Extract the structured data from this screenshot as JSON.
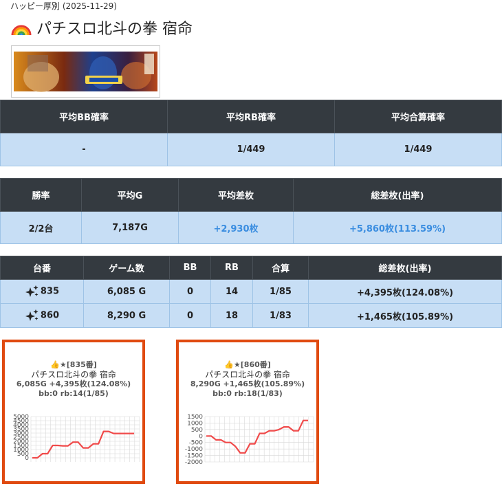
{
  "header": {
    "subtitle": "ハッピー厚別 (2025-11-29)",
    "title": "パチスロ北斗の拳 宿命",
    "icon": "rainbow-icon"
  },
  "summary1": {
    "headers": [
      "平均BB確率",
      "平均RB確率",
      "平均合算確率"
    ],
    "values": [
      "-",
      "1/449",
      "1/449"
    ]
  },
  "summary2": {
    "headers": [
      "勝率",
      "平均G",
      "平均差枚",
      "総差枚(出率)"
    ],
    "values": [
      "2/2台",
      "7,187G",
      "+2,930枚",
      "+5,860枚(113.59%)"
    ]
  },
  "machines": {
    "headers": [
      "台番",
      "ゲーム数",
      "BB",
      "RB",
      "合算",
      "総差枚(出率)"
    ],
    "rows": [
      {
        "no": "835",
        "games": "6,085 G",
        "bb": "0",
        "rb": "14",
        "total": "1/85",
        "diff": "+4,395枚(124.08%)"
      },
      {
        "no": "860",
        "games": "8,290 G",
        "bb": "0",
        "rb": "18",
        "total": "1/83",
        "diff": "+1,465枚(105.89%)"
      }
    ]
  },
  "cards": [
    {
      "label": "👍★[835番]",
      "name": "パチスロ北斗の拳 宿命",
      "stats": "6,085G +4,395枚(124.08%)",
      "bbrb": "bb:0 rb:14(1/85)"
    },
    {
      "label": "👍★[860番]",
      "name": "パチスロ北斗の拳 宿命",
      "stats": "8,290G +1,465枚(105.89%)",
      "bbrb": "bb:0 rb:18(1/83)"
    }
  ],
  "chart_data": [
    {
      "type": "line",
      "color": "#f04a4a",
      "ylim": [
        -500,
        5000
      ],
      "ticks": [
        "5000",
        "4500",
        "4000",
        "3500",
        "3000",
        "2500",
        "2000",
        "1500",
        "1000",
        "500",
        "0"
      ],
      "values": [
        0,
        0,
        500,
        500,
        1500,
        1500,
        1450,
        1450,
        1900,
        1900,
        1200,
        1200,
        1700,
        1700,
        3200,
        3200,
        2950,
        2950,
        2950,
        2950,
        2950
      ]
    },
    {
      "type": "line",
      "color": "#f04a4a",
      "ylim": [
        -2000,
        1500
      ],
      "ticks": [
        "1500",
        "1000",
        "500",
        "0",
        "-500",
        "-1000",
        "-1500",
        "-2000"
      ],
      "values": [
        0,
        0,
        -300,
        -300,
        -500,
        -500,
        -800,
        -1300,
        -1300,
        -600,
        -600,
        200,
        200,
        400,
        400,
        500,
        700,
        700,
        400,
        400,
        1200,
        1200
      ]
    }
  ]
}
